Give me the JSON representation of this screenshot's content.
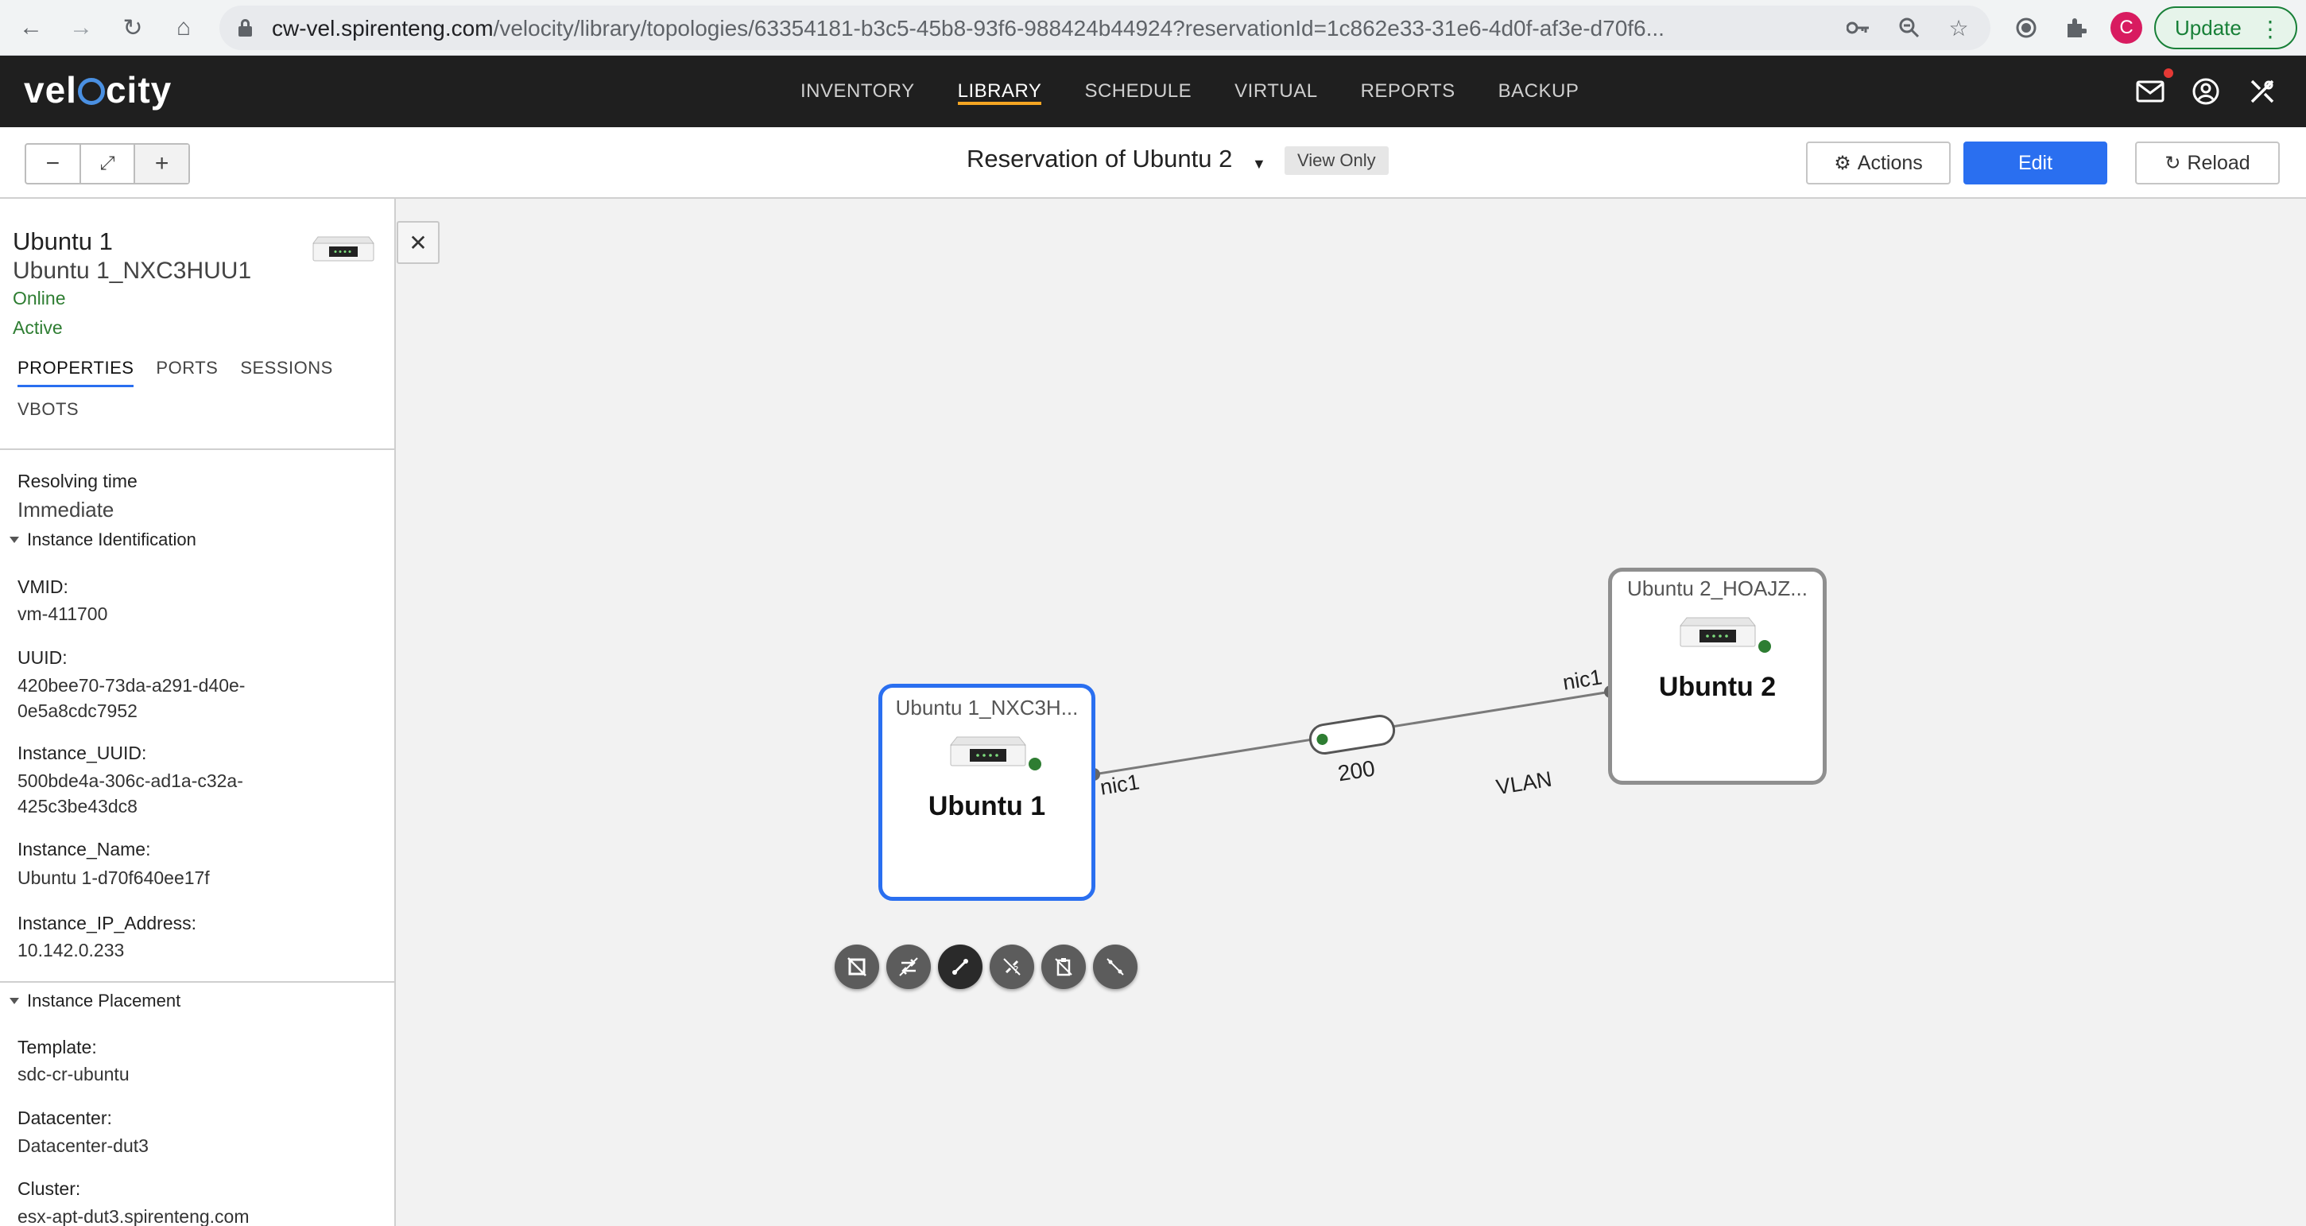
{
  "browser": {
    "url_host": "cw-vel.spirenteng.com",
    "url_path": "/velocity/library/topologies/63354181-b3c5-45b8-93f6-988424b44924?reservationId=1c862e33-31e6-4d0f-af3e-d70f6...",
    "profile_initial": "C",
    "update_label": "Update"
  },
  "app": {
    "logo": {
      "pre": "vel",
      "post": "city"
    },
    "nav": [
      {
        "label": "INVENTORY"
      },
      {
        "label": "LIBRARY"
      },
      {
        "label": "SCHEDULE"
      },
      {
        "label": "VIRTUAL"
      },
      {
        "label": "REPORTS"
      },
      {
        "label": "BACKUP"
      }
    ],
    "active_nav": "LIBRARY"
  },
  "toolbar": {
    "zoom_out": "−",
    "zoom_fit": "⤢",
    "zoom_in": "+",
    "reservation_title": "Reservation of Ubuntu 2",
    "view_only": "View Only",
    "actions_label": "Actions",
    "edit_label": "Edit",
    "reload_label": "Reload"
  },
  "panel": {
    "device_name": "Ubuntu 1",
    "device_instance": "Ubuntu 1_NXC3HUU1",
    "status_online": "Online",
    "status_active": "Active",
    "tabs": [
      {
        "label": "PROPERTIES"
      },
      {
        "label": "PORTS"
      },
      {
        "label": "SESSIONS"
      }
    ],
    "tab_row2": "VBOTS",
    "resolving_time_label": "Resolving time",
    "resolving_time_value": "Immediate",
    "section_instance_id": "Instance Identification",
    "props_id": [
      {
        "label": "VMID:",
        "value": "vm-411700"
      },
      {
        "label": "UUID:",
        "value": "420bee70-73da-a291-d40e-\n0e5a8cdc7952"
      },
      {
        "label": "Instance_UUID:",
        "value": "500bde4a-306c-ad1a-c32a-\n425c3be43dc8"
      },
      {
        "label": "Instance_Name:",
        "value": "Ubuntu 1-d70f640ee17f"
      },
      {
        "label": "Instance_IP_Address:",
        "value": "10.142.0.233"
      }
    ],
    "section_placement": "Instance Placement",
    "props_placement": [
      {
        "label": "Template:",
        "value": "sdc-cr-ubuntu"
      },
      {
        "label": "Datacenter:",
        "value": "Datacenter-dut3"
      },
      {
        "label": "Cluster:",
        "value": "esx-apt-dut3.spirenteng.com"
      }
    ]
  },
  "topology": {
    "node1": {
      "subtitle": "Ubuntu 1_NXC3H...",
      "title": "Ubuntu 1",
      "port": "nic1",
      "status_color": "#2e7d32"
    },
    "node2": {
      "subtitle": "Ubuntu 2_HOAJZ...",
      "title": "Ubuntu 2",
      "port": "nic1",
      "status_color": "#2e7d32"
    },
    "link": {
      "label": "VLAN",
      "vlan_id": "200"
    },
    "action_icons": [
      "crop-icon",
      "swap-icon",
      "link-icon",
      "unlink-icon",
      "clipboard-icon",
      "disconnect-icon"
    ]
  },
  "colors": {
    "accent_blue": "#2a6ff0",
    "nav_underline": "#f5a623",
    "header_bg": "#1f1f1f",
    "online_green": "#2e7d32",
    "canvas_bg": "#f2f2f2"
  }
}
